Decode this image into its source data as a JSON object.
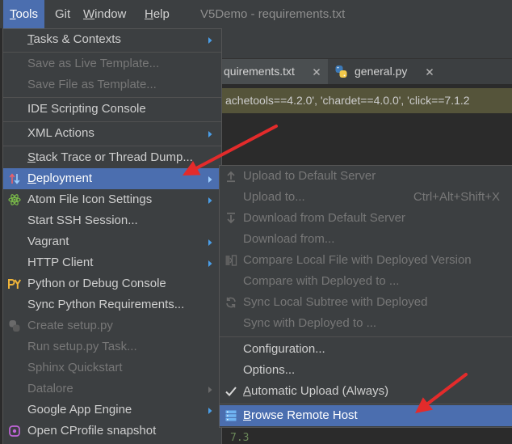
{
  "menubar": {
    "items": [
      {
        "label": "Tools",
        "active": true
      },
      {
        "label": "Git"
      },
      {
        "label": "Window"
      },
      {
        "label": "Help"
      }
    ],
    "title": "V5Demo - requirements.txt"
  },
  "editor": {
    "tabs": [
      {
        "label": "quirements.txt",
        "active": true
      },
      {
        "label": "general.py",
        "icon": "python-file-icon"
      }
    ],
    "notification": "achetools==4.2.0', 'chardet==4.0.0', 'click==7.1.2",
    "code_line": "7.3"
  },
  "tools_menu": {
    "items": [
      {
        "label": "Tasks & Contexts",
        "enabled": true,
        "submenu": true
      },
      {
        "label": "Save as Live Template...",
        "enabled": false
      },
      {
        "label": "Save File as Template...",
        "enabled": false
      },
      {
        "label": "IDE Scripting Console",
        "enabled": true
      },
      {
        "label": "XML Actions",
        "enabled": true,
        "submenu": true
      },
      {
        "label": "Stack Trace or Thread Dump...",
        "enabled": true
      },
      {
        "label": "Deployment",
        "enabled": true,
        "submenu": true,
        "highlighted": true,
        "icon": "deployment-icon"
      },
      {
        "label": "Atom File Icon Settings",
        "enabled": true,
        "submenu": true,
        "icon": "atom-icon"
      },
      {
        "label": "Start SSH Session...",
        "enabled": true
      },
      {
        "label": "Vagrant",
        "enabled": true,
        "submenu": true
      },
      {
        "label": "HTTP Client",
        "enabled": true,
        "submenu": true
      },
      {
        "label": "Python or Debug Console",
        "enabled": true,
        "icon": "python-console-icon"
      },
      {
        "label": "Sync Python Requirements...",
        "enabled": true
      },
      {
        "label": "Create setup.py",
        "enabled": false,
        "icon": "python-icon"
      },
      {
        "label": "Run setup.py Task...",
        "enabled": false
      },
      {
        "label": "Sphinx Quickstart",
        "enabled": false
      },
      {
        "label": "Datalore",
        "enabled": false,
        "submenu": true
      },
      {
        "label": "Google App Engine",
        "enabled": true,
        "submenu": true
      },
      {
        "label": "Open CProfile snapshot",
        "enabled": true,
        "icon": "cprofile-icon"
      }
    ]
  },
  "deployment_menu": {
    "items": [
      {
        "label": "Upload to Default Server",
        "enabled": false,
        "icon": "upload-icon"
      },
      {
        "label": "Upload to...",
        "enabled": false,
        "shortcut": "Ctrl+Alt+Shift+X"
      },
      {
        "label": "Download from Default Server",
        "enabled": false,
        "icon": "download-icon"
      },
      {
        "label": "Download from...",
        "enabled": false
      },
      {
        "label": "Compare Local File with Deployed Version",
        "enabled": false,
        "icon": "compare-icon"
      },
      {
        "label": "Compare with Deployed to ...",
        "enabled": false
      },
      {
        "label": "Sync Local Subtree with Deployed",
        "enabled": false,
        "icon": "sync-icon"
      },
      {
        "label": "Sync with Deployed to ...",
        "enabled": false
      },
      {
        "label": "Configuration...",
        "enabled": true
      },
      {
        "label": "Options...",
        "enabled": true
      },
      {
        "label": "Automatic Upload (Always)",
        "enabled": true,
        "checked": true
      },
      {
        "label": "Browse Remote Host",
        "enabled": true,
        "highlighted": true,
        "icon": "server-icon"
      }
    ]
  },
  "colors": {
    "menu_background": "#3c3f41",
    "selection": "#4b6eaf",
    "text": "#cfcfcf",
    "disabled_text": "#777777",
    "editor_background": "#2b2b2b",
    "notification_background": "#55543a",
    "annotation_arrow": "#e32b2b"
  }
}
